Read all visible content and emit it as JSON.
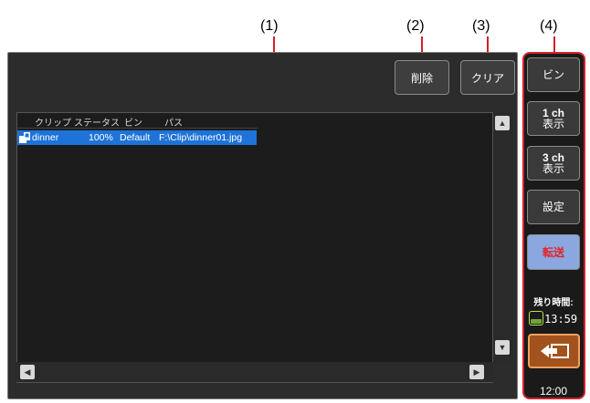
{
  "callouts": [
    "(1)",
    "(2)",
    "(3)",
    "(4)"
  ],
  "toolbar": {
    "delete_label": "削除",
    "clear_label": "クリア"
  },
  "clip_list": {
    "columns": [
      "クリップ",
      "ステータス",
      "ビン",
      "パス"
    ],
    "rows": [
      {
        "clip": "dinner",
        "status": "100%",
        "bin": "Default",
        "path": "F:\\Clip\\dinner01.jpg"
      }
    ]
  },
  "sidebar": {
    "bin_label": "ビン",
    "ch1_top": "1 ch",
    "ch1_bottom": "表示",
    "ch3_top": "3 ch",
    "ch3_bottom": "表示",
    "settings_label": "設定",
    "transfer_label": "転送",
    "remaining_label": "残り時間:",
    "remaining_time": "13:59",
    "clock": "12:00"
  },
  "colors": {
    "accent": "#d3202a",
    "selection": "#1e73d8",
    "transfer_bg": "#8aa7df",
    "back_bg": "#a2521c"
  },
  "icons": [
    "clip-icon",
    "scroll-up-icon",
    "scroll-down-icon",
    "scroll-left-icon",
    "scroll-right-icon",
    "battery-icon",
    "back-icon"
  ]
}
